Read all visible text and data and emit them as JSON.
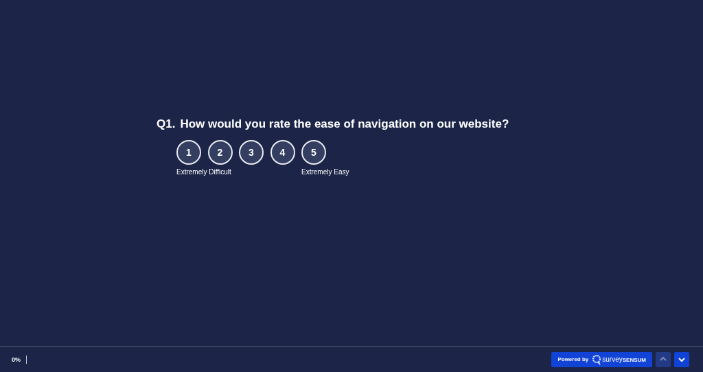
{
  "question": {
    "number": "Q1.",
    "text": "How would you rate the ease of navigation on our website?",
    "options": [
      {
        "label": "1",
        "selected": false
      },
      {
        "label": "2",
        "selected": false
      },
      {
        "label": "3",
        "selected": false
      },
      {
        "label": "4",
        "selected": false
      },
      {
        "label": "5",
        "selected": false
      }
    ],
    "min_label": "Extremely Difficult",
    "max_label": "Extremely Easy"
  },
  "footer": {
    "progress_text": "0%",
    "progress": {
      "level": 0
    },
    "powered_by": "Powered by",
    "brand": "survey**SENSUM**",
    "nav_buttons": [
      {
        "kind": "up",
        "disabled": true
      },
      {
        "kind": "down",
        "disabled": false
      }
    ]
  }
}
